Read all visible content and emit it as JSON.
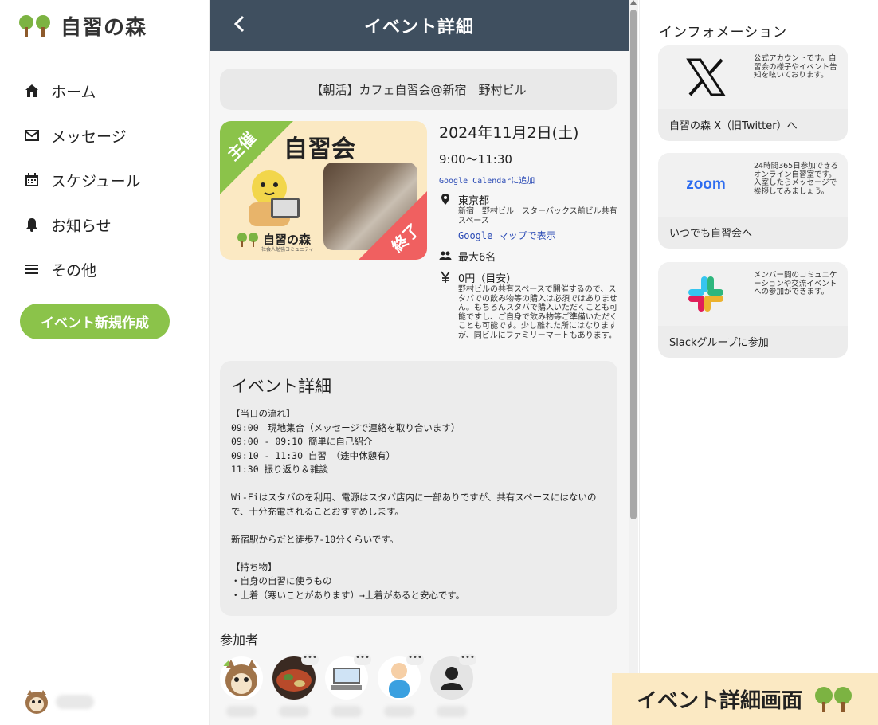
{
  "app": {
    "name": "自習の森"
  },
  "nav": [
    {
      "label": "ホーム",
      "icon": "home-icon"
    },
    {
      "label": "メッセージ",
      "icon": "mail-icon"
    },
    {
      "label": "スケジュール",
      "icon": "calendar-icon"
    },
    {
      "label": "お知らせ",
      "icon": "bell-icon"
    },
    {
      "label": "その他",
      "icon": "menu-icon"
    }
  ],
  "create_event_label": "イベント新規作成",
  "header": {
    "title": "イベント詳細"
  },
  "event": {
    "title": "【朝活】カフェ自習会@新宿　野村ビル",
    "thumb": {
      "host_label": "主催",
      "title": "自習会",
      "ended_label": "終了",
      "logo_name": "自習の森",
      "logo_sub": "社会人勉強コミュニティ"
    },
    "date": "2024年11月2日(土)",
    "time": "9:00〜11:30",
    "gcal_link": "Google Calendarに追加",
    "location": {
      "prefecture": "東京都",
      "detail": "新宿　野村ビル　スターバックス前ビル共有スペース",
      "map_link": "Google マップで表示"
    },
    "capacity": "最大6名",
    "fee": "0円（目安）",
    "fee_note": "野村ビルの共有スペースで開催するので、スタバでの飲み物等の購入は必須ではありません。もちろんスタバで購入いただくことも可能ですし、ご自身で飲み物等ご準備いただくことも可能です。少し離れた所にはなりますが、同ビルにファミリーマートもあります。"
  },
  "detail": {
    "heading": "イベント詳細",
    "body": "【当日の流れ】\n09:00　現地集合（メッセージで連絡を取り合います）\n09:00 - 09:10 簡単に自己紹介\n09:10 - 11:30 自習　（途中休憩有）\n11:30 振り返り＆雑談\n\nWi-Fiはスタバのを利用、電源はスタバ店内に一部ありですが、共有スペースにはないので、十分充電されることおすすめします。\n\n新宿駅からだと徒歩7-10分くらいです。\n\n【持ち物】\n・自身の自習に使うもの\n・上着（寒いことがあります）→上着があると安心です。"
  },
  "participants_title": "参加者",
  "participants_dots": "•••",
  "info": {
    "title": "インフォメーション",
    "cards": [
      {
        "desc": "公式アカウントです。自習会の様子やイベント告知を呟いております。",
        "cta": "自習の森 X（旧Twitter）へ",
        "logo": "x-logo-icon"
      },
      {
        "desc": "24時間365日参加できるオンライン自習室です。入室したらメッセージで挨拶してみましょう。",
        "cta": "いつでも自習会へ",
        "logo_text": "zoom"
      },
      {
        "desc": "メンバー間のコミュニケーションや交流イベントへの参加ができます。",
        "cta": "Slackグループに参加",
        "logo": "slack-logo-icon"
      }
    ]
  },
  "banner": {
    "text": "イベント詳細画面"
  },
  "colors": {
    "header": "#3f4f5f",
    "accent": "#8bc34a",
    "ended": "#f06060",
    "link": "#2a4ab5",
    "banner": "#fbe9c3"
  }
}
